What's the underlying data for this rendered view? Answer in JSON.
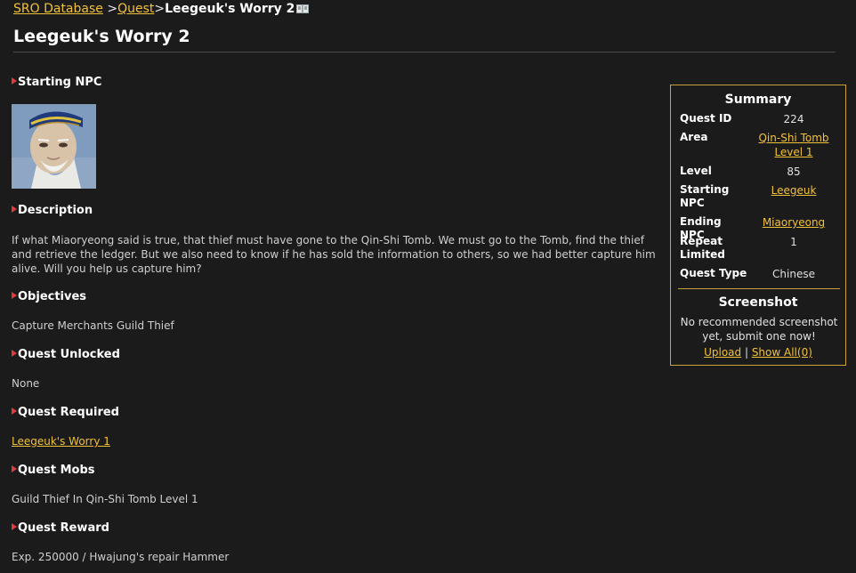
{
  "breadcrumb": {
    "root": "SRO Database",
    "sep1": " >",
    "section": "Quest",
    "sep2": ">",
    "current": "Leegeuk's Worry 2"
  },
  "title": "Leegeuk's Worry 2",
  "sections": {
    "starting_npc": {
      "heading": "Starting NPC"
    },
    "description": {
      "heading": "Description",
      "text": "If what Miaoryeong said is true, that thief must have gone to the Qin-Shi Tomb. We must go to the Tomb, find the thief and retrieve the ledger. But we also need to know if he has sold the information to others, so we had better capture him alive. Will you help us capture him?"
    },
    "objectives": {
      "heading": "Objectives",
      "text": "Capture Merchants Guild Thief"
    },
    "quest_unlocked": {
      "heading": "Quest Unlocked",
      "text": "None"
    },
    "quest_required": {
      "heading": "Quest Required",
      "link": "Leegeuk's Worry 1"
    },
    "quest_mobs": {
      "heading": "Quest Mobs",
      "text": "Guild Thief In Qin-Shi Tomb Level 1"
    },
    "quest_reward": {
      "heading": "Quest Reward",
      "text": "Exp. 250000 / Hwajung's repair Hammer"
    }
  },
  "summary": {
    "title": "Summary",
    "quest_id_label": "Quest ID",
    "quest_id": "224",
    "area_label": "Area",
    "area_line1": "Qin-Shi Tomb",
    "area_line2": "Level 1",
    "level_label": "Level",
    "level": "85",
    "starting_npc_label": "Starting NPC",
    "starting_npc": "Leegeuk",
    "ending_npc_label": "Ending NPC",
    "ending_npc": "Miaoryeong",
    "repeat_label": "Repeat Limited",
    "repeat": "1",
    "quest_type_label": "Quest Type",
    "quest_type": "Chinese"
  },
  "screenshot": {
    "title": "Screenshot",
    "text": "No recommended screenshot yet, submit one now!",
    "upload": "Upload",
    "divider": " | ",
    "show_all": "Show All(0)"
  },
  "colors": {
    "background": "#1b1b1b",
    "link": "#f2c13a",
    "accent_border": "#c9a23a",
    "arrow": "#e23b3b"
  },
  "icons": {
    "breadcrumb_icon": "book-icon",
    "section_marker": "arrow-right-icon"
  }
}
